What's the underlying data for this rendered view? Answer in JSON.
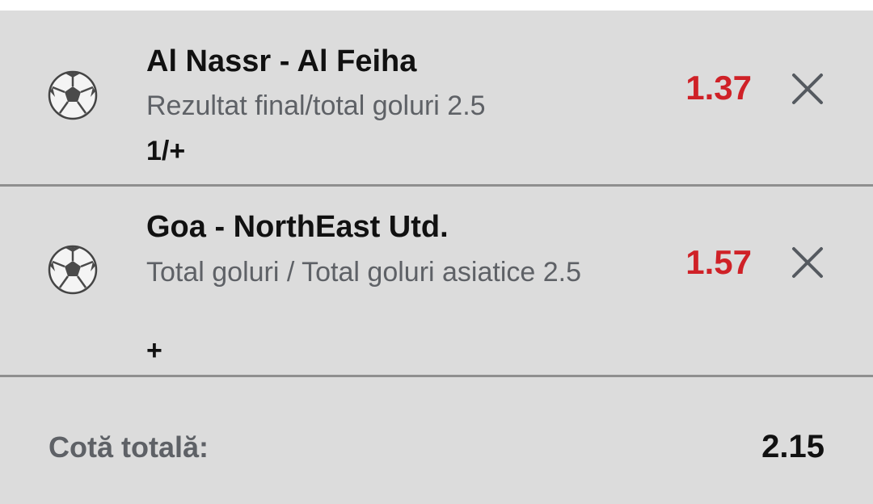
{
  "bets": [
    {
      "sport_icon": "soccer-ball-icon",
      "match": "Al Nassr - Al Feiha",
      "market": "Rezultat final/total goluri 2.5",
      "selection": "1/+",
      "odds": "1.37",
      "remove_icon": "close-icon"
    },
    {
      "sport_icon": "soccer-ball-icon",
      "match": "Goa - NorthEast Utd.",
      "market": "Total goluri / Total goluri asiatice 2.5",
      "selection": "+",
      "odds": "1.57",
      "remove_icon": "close-icon"
    }
  ],
  "summary": {
    "total_label": "Cotă totală:",
    "total_value": "2.15"
  },
  "colors": {
    "background": "#dcdcdc",
    "odds": "#cf2127",
    "secondary_text": "#5e6166",
    "primary_text": "#111111",
    "divider": "#8f8f8f"
  }
}
